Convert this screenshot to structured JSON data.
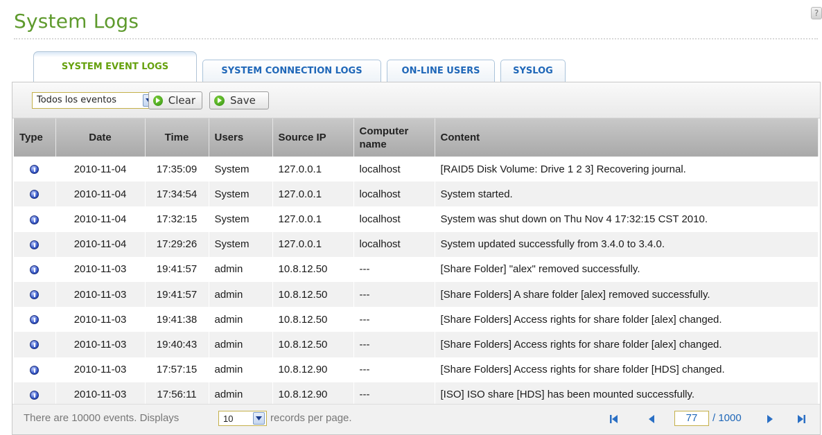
{
  "page": {
    "title": "System Logs"
  },
  "tabs": [
    {
      "label": "SYSTEM EVENT LOGS",
      "active": true
    },
    {
      "label": "SYSTEM CONNECTION LOGS",
      "active": false
    },
    {
      "label": "ON-LINE USERS",
      "active": false
    },
    {
      "label": "SYSLOG",
      "active": false
    }
  ],
  "toolbar": {
    "filter_value": "Todos los eventos",
    "clear_label": "Clear",
    "save_label": "Save"
  },
  "table": {
    "columns": [
      "Type",
      "Date",
      "Time",
      "Users",
      "Source IP",
      "Computer name",
      "Content"
    ],
    "rows": [
      {
        "type_icon": "info-icon",
        "date": "2010-11-04",
        "time": "17:35:09",
        "user": "System",
        "source_ip": "127.0.0.1",
        "computer": "localhost",
        "content": "[RAID5 Disk Volume: Drive 1 2 3] Recovering journal."
      },
      {
        "type_icon": "info-icon",
        "date": "2010-11-04",
        "time": "17:34:54",
        "user": "System",
        "source_ip": "127.0.0.1",
        "computer": "localhost",
        "content": "System started."
      },
      {
        "type_icon": "info-icon",
        "date": "2010-11-04",
        "time": "17:32:15",
        "user": "System",
        "source_ip": "127.0.0.1",
        "computer": "localhost",
        "content": "System was shut down on Thu Nov 4 17:32:15 CST 2010."
      },
      {
        "type_icon": "info-icon",
        "date": "2010-11-04",
        "time": "17:29:26",
        "user": "System",
        "source_ip": "127.0.0.1",
        "computer": "localhost",
        "content": "System updated successfully from 3.4.0 to 3.4.0."
      },
      {
        "type_icon": "info-icon",
        "date": "2010-11-03",
        "time": "19:41:57",
        "user": "admin",
        "source_ip": "10.8.12.50",
        "computer": "---",
        "content": "[Share Folder] \"alex\" removed successfully."
      },
      {
        "type_icon": "info-icon",
        "date": "2010-11-03",
        "time": "19:41:57",
        "user": "admin",
        "source_ip": "10.8.12.50",
        "computer": "---",
        "content": "[Share Folders] A share folder [alex] removed successfully."
      },
      {
        "type_icon": "info-icon",
        "date": "2010-11-03",
        "time": "19:41:38",
        "user": "admin",
        "source_ip": "10.8.12.50",
        "computer": "---",
        "content": "[Share Folders] Access rights for share folder [alex] changed."
      },
      {
        "type_icon": "info-icon",
        "date": "2010-11-03",
        "time": "19:40:43",
        "user": "admin",
        "source_ip": "10.8.12.50",
        "computer": "---",
        "content": "[Share Folders] Access rights for share folder [alex] changed."
      },
      {
        "type_icon": "info-icon",
        "date": "2010-11-03",
        "time": "17:57:15",
        "user": "admin",
        "source_ip": "10.8.12.90",
        "computer": "---",
        "content": "[Share Folders] Access rights for share folder [HDS] changed."
      },
      {
        "type_icon": "info-icon",
        "date": "2010-11-03",
        "time": "17:56:11",
        "user": "admin",
        "source_ip": "10.8.12.90",
        "computer": "---",
        "content": "[ISO] ISO share [HDS] has been mounted successfully."
      }
    ]
  },
  "footer": {
    "prefix": "There are 10000 events. Displays",
    "per_page": "10",
    "suffix": "records per page.",
    "current_page": "77",
    "total_pages": "/ 1000"
  },
  "colors": {
    "title": "#5e9a2d",
    "tab_active_text": "#66a10e",
    "tab_text": "#1f67b8",
    "header_bg": "#b6b6b6",
    "info_icon": "#3658c8"
  }
}
